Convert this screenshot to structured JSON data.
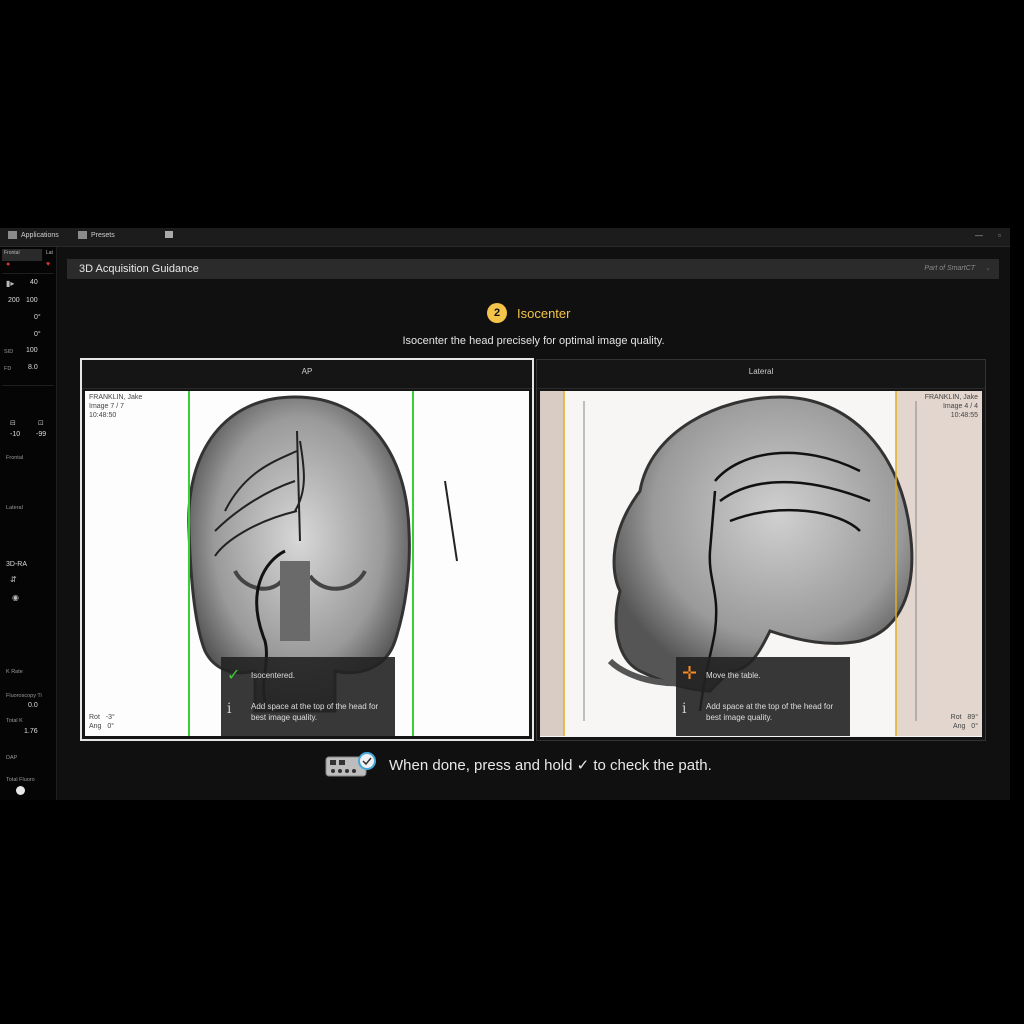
{
  "topbar": {
    "applications": "Applications",
    "presets": "Presets"
  },
  "left": {
    "tab_frontal": "Frontal",
    "tab_lat": "Lat",
    "kv": "40",
    "v200": "200",
    "v100a": "100",
    "angle1": "0°",
    "angle2": "0°",
    "sid_label": "SID",
    "sid_value": "100",
    "fd_label": "FD",
    "fd_value": "8.0",
    "val_neg10": "-10",
    "val_neg99": "-99",
    "frontal_label": "Frontal",
    "lateral_label": "Lateral",
    "mode": "3D-RA",
    "k_rate_label": "K Rate",
    "fluoro_label": "Fluoroscopy Ti",
    "fluoro_value": "0.0",
    "total_k_label": "Total K",
    "total_k_value": "1.76",
    "dap_label": "DAP",
    "total_fluoro_label": "Total Fluoro"
  },
  "main": {
    "header_title": "3D Acquisition Guidance",
    "brand": "Part of SmartCT",
    "step_number": "2",
    "step_title": "Isocenter",
    "instruction": "Isocenter the head precisely for optimal image quality.",
    "bottom_message": "When done, press and hold ✓ to check the path."
  },
  "ap": {
    "label": "AP",
    "patient": "FRANKLIN, Jake",
    "image": "Image 7 / 7",
    "time": "10:48:50",
    "rot_label": "Rot",
    "rot_value": "-3°",
    "ang_label": "Ang",
    "ang_value": "0°",
    "status": "Isocentered.",
    "hint": "Add space at the top of the head for best image quality."
  },
  "lateral": {
    "label": "Lateral",
    "patient": "FRANKLIN, Jake",
    "image": "Image 4 / 4",
    "time": "10:48:55",
    "rot_label": "Rot",
    "rot_value": "89°",
    "ang_label": "Ang",
    "ang_value": "0°",
    "status": "Move the table.",
    "hint": "Add space at the top of the head for best image quality."
  },
  "colors": {
    "accent": "#f4c44a",
    "ok": "#3ccc3c",
    "warn": "#ff8a1f",
    "ap_guide": "#35d235",
    "lat_guide": "#e0b020"
  }
}
